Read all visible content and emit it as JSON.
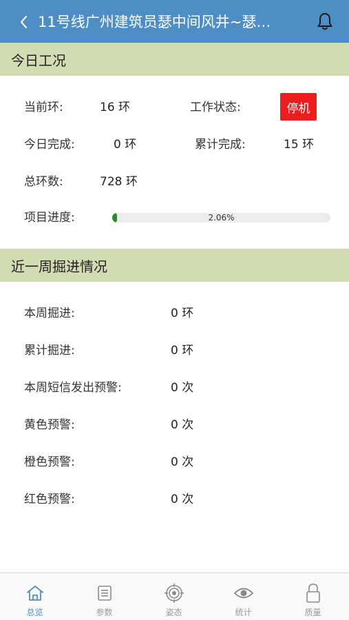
{
  "header": {
    "title": "11号线广州建筑员瑟中间风井~瑟…"
  },
  "today": {
    "section_title": "今日工况",
    "current_ring_label": "当前环:",
    "current_ring_value": "16 环",
    "work_status_label": "工作状态:",
    "work_status_value": "停机",
    "today_done_label": "今日完成:",
    "today_done_value": "0 环",
    "total_done_label": "累计完成:",
    "total_done_value": "15 环",
    "total_rings_label": "总环数:",
    "total_rings_value": "728 环",
    "progress_label": "项目进度:",
    "progress_text": "2.06%",
    "progress_fraction": 0.0206
  },
  "week": {
    "section_title": "近一周掘进情况",
    "rows": [
      {
        "label": "本周掘进:",
        "value": "0 环"
      },
      {
        "label": "累计掘进:",
        "value": "0 环"
      },
      {
        "label": "本周短信发出预警:",
        "value": "0 次"
      },
      {
        "label": "黄色预警:",
        "value": "0 次"
      },
      {
        "label": "橙色预警:",
        "value": "0 次"
      },
      {
        "label": "红色预警:",
        "value": "0 次"
      }
    ]
  },
  "tabs": [
    {
      "label": "总览",
      "icon": "home-icon",
      "active": true
    },
    {
      "label": "参数",
      "icon": "list-icon",
      "active": false
    },
    {
      "label": "姿态",
      "icon": "target-icon",
      "active": false
    },
    {
      "label": "统计",
      "icon": "eye-icon",
      "active": false
    },
    {
      "label": "质量",
      "icon": "lock-icon",
      "active": false
    }
  ],
  "colors": {
    "header_bg": "#4d8fc4",
    "section_bg": "#d2dbb2",
    "status_red": "#ee1c1c",
    "progress_green": "#2c8a2c",
    "tab_active": "#4d8fc4"
  }
}
